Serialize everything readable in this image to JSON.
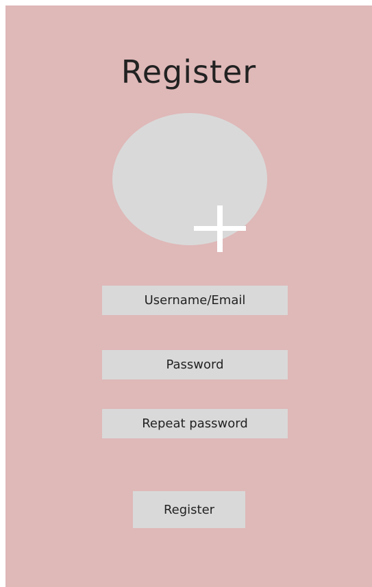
{
  "page": {
    "title": "Register",
    "background_color": "#dfb8b8"
  },
  "avatar": {
    "add_icon": "plus-icon"
  },
  "form": {
    "username_placeholder": "Username/Email",
    "password_placeholder": "Password",
    "repeat_password_placeholder": "Repeat password"
  },
  "actions": {
    "register_label": "Register"
  }
}
